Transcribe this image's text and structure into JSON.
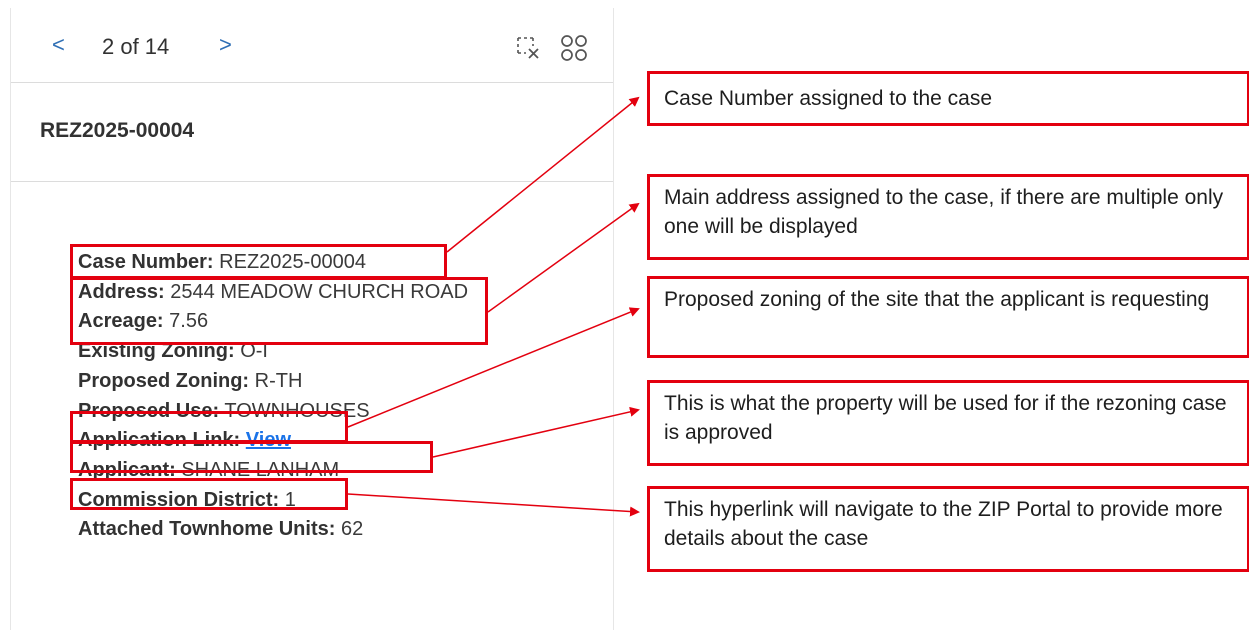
{
  "pager": {
    "prev_label": "<",
    "next_label": ">",
    "indicator": "2 of 14"
  },
  "header": {
    "title": "REZ2025-00004"
  },
  "attributes": [
    {
      "label": "Case Number:",
      "value": "REZ2025-00004"
    },
    {
      "label": "Address:",
      "value": "2544 MEADOW CHURCH ROAD"
    },
    {
      "label": "Acreage:",
      "value": "7.56"
    },
    {
      "label": "Existing Zoning:",
      "value": "O-I"
    },
    {
      "label": "Proposed Zoning:",
      "value": "R-TH"
    },
    {
      "label": "Proposed Use:",
      "value": "TOWNHOUSES"
    },
    {
      "label": "Application Link:",
      "value": "View"
    },
    {
      "label": "Applicant:",
      "value": "SHANE LANHAM"
    },
    {
      "label": "Commission District:",
      "value": "1"
    },
    {
      "label": "Attached Townhome Units:",
      "value": "62"
    }
  ],
  "callouts": [
    "Case Number assigned to the case",
    "Main address assigned to the case, if there are multiple only one will be displayed",
    "Proposed zoning of the site that the applicant is requesting",
    "This is what the property will be used for if the rezoning case is approved",
    "This hyperlink will navigate to the ZIP Portal to provide more details about the case"
  ],
  "icons": {
    "clear_selection": "clear-selection-icon",
    "grid": "grid-icon"
  },
  "colors": {
    "highlight": "#e3000f",
    "link": "#1a73e8",
    "nav": "#2f6fb5"
  }
}
